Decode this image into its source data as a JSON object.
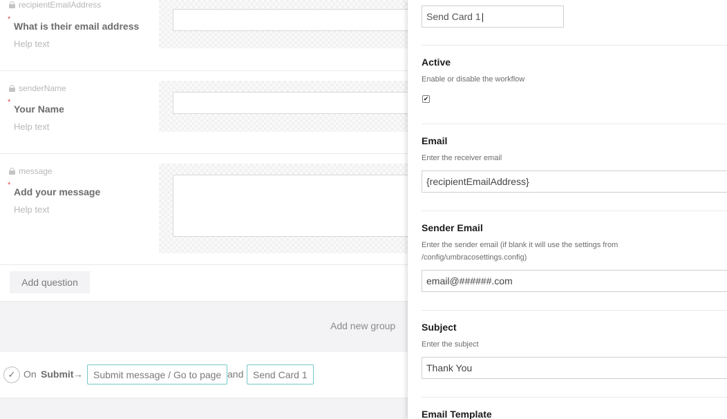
{
  "questions": [
    {
      "alias": "recipientEmailAddress",
      "label": "What is their email address",
      "help": "Help text"
    },
    {
      "alias": "senderName",
      "label": "Your Name",
      "help": "Help text"
    },
    {
      "alias": "message",
      "label": "Add your message",
      "help": "Help text"
    }
  ],
  "add_question_label": "Add question",
  "add_group_label": "Add new group",
  "workflow": {
    "on": "On",
    "event": "Submit",
    "arrow": "→",
    "action1": "Submit message / Go to page",
    "and": "and",
    "action2": "Send Card 1"
  },
  "panel": {
    "name_value": "Send Card 1",
    "active": {
      "title": "Active",
      "desc": "Enable or disable the workflow",
      "checked": true,
      "check_glyph": "✔"
    },
    "email": {
      "title": "Email",
      "desc": "Enter the receiver email",
      "value": "{recipientEmailAddress}"
    },
    "sender_email": {
      "title": "Sender Email",
      "desc": "Enter the sender email (if blank it will use the settings from /config/umbracosettings.config)",
      "value": "email@######.com"
    },
    "subject": {
      "title": "Subject",
      "desc": "Enter the subject",
      "value": "Thank You"
    },
    "email_template": {
      "title": "Email Template"
    }
  },
  "icons": {
    "lock": "lock-icon",
    "check_circle": "check-circle-icon",
    "required": "*",
    "check_mark": "✓"
  },
  "colors": {
    "accent_border": "#74c7c7",
    "required": "#e04e4e",
    "panel_bg": "#ffffff"
  }
}
